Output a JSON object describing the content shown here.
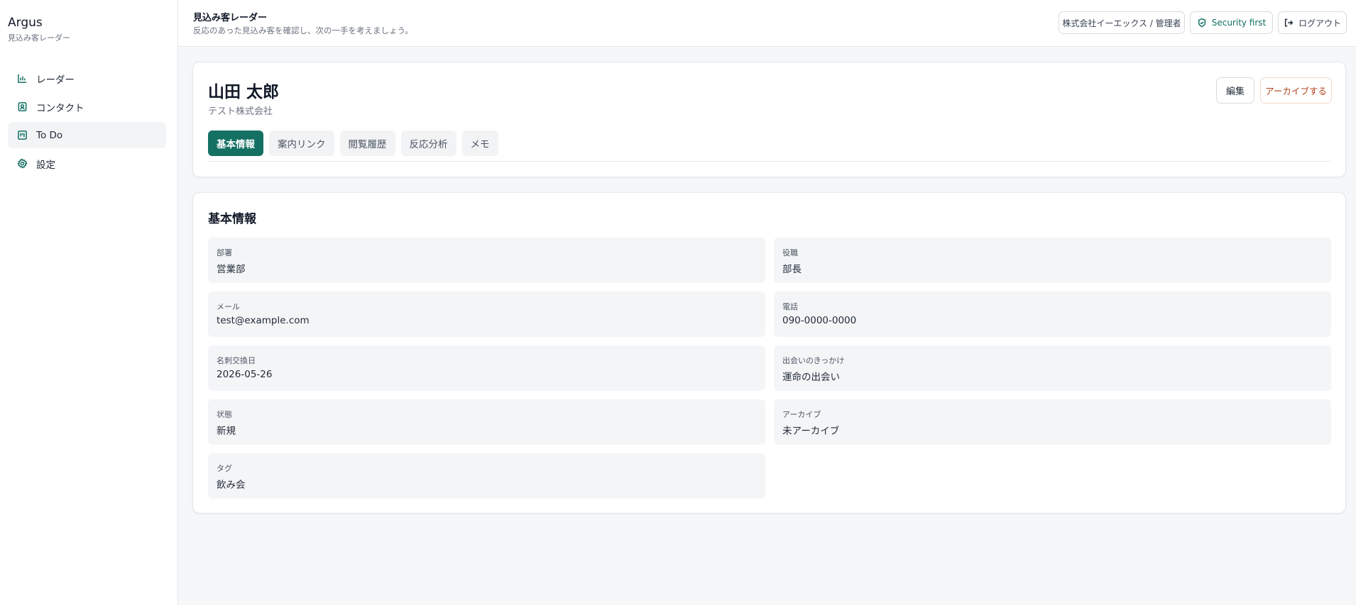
{
  "sidebar": {
    "brand": "Argus",
    "brand_sub": "見込み客レーダー",
    "items": [
      {
        "label": "レーダー",
        "icon": "bar-chart-icon"
      },
      {
        "label": "コンタクト",
        "icon": "contact-icon"
      },
      {
        "label": "To Do",
        "icon": "kanban-icon"
      },
      {
        "label": "設定",
        "icon": "gear-icon"
      }
    ],
    "active_index": 2
  },
  "header": {
    "title": "見込み客レーダー",
    "subtitle": "反応のあった見込み客を確認し、次の一手を考えましょう。",
    "org_label": "株式会社イーエックス / 管理者",
    "security_label": "Security first",
    "logout_label": "ログアウト"
  },
  "profile": {
    "name": "山田 太郎",
    "company": "テスト株式会社",
    "edit_label": "編集",
    "archive_label": "アーカイブする",
    "tabs": [
      "基本情報",
      "案内リンク",
      "閲覧履歴",
      "反応分析",
      "メモ"
    ],
    "active_tab": 0
  },
  "info": {
    "title": "基本情報",
    "fields": [
      {
        "label": "部署",
        "value": "営業部"
      },
      {
        "label": "役職",
        "value": "部長"
      },
      {
        "label": "メール",
        "value": "test@example.com"
      },
      {
        "label": "電話",
        "value": "090-0000-0000"
      },
      {
        "label": "名刺交換日",
        "value": "2026-05-26"
      },
      {
        "label": "出会いのきっかけ",
        "value": "運命の出会い"
      },
      {
        "label": "状態",
        "value": "新規"
      },
      {
        "label": "アーカイブ",
        "value": "未アーカイブ"
      },
      {
        "label": "タグ",
        "value": "飲み会"
      }
    ]
  },
  "colors": {
    "accent": "#147063",
    "archive_text": "#b2431a",
    "background": "#f6f7f9"
  }
}
